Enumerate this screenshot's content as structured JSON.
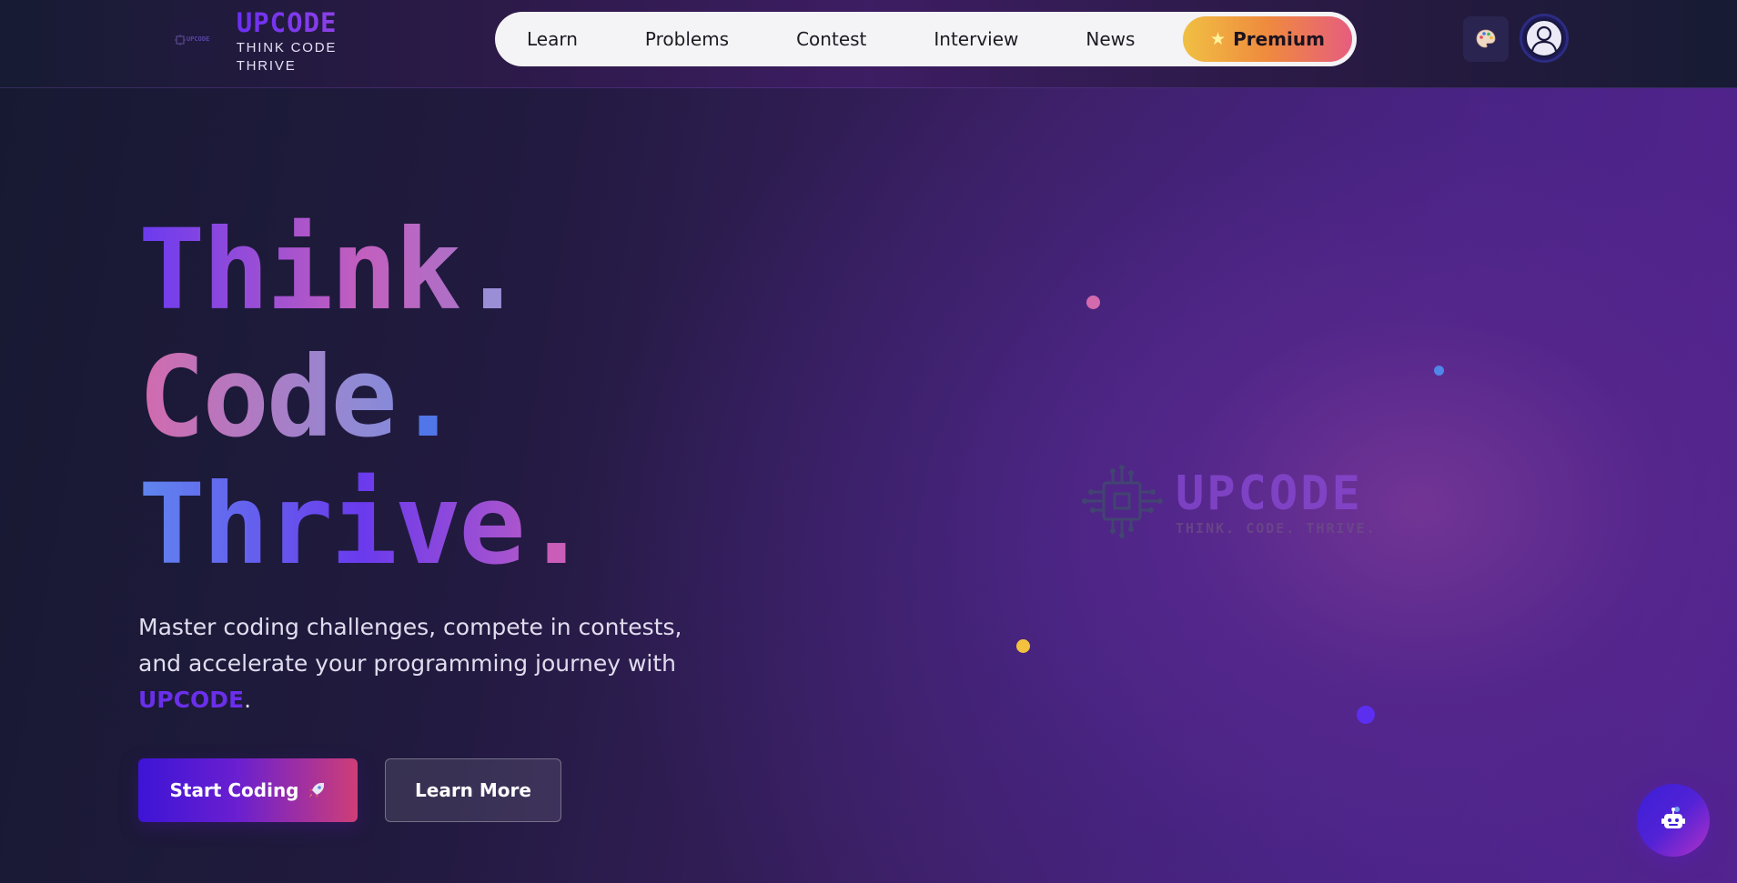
{
  "header": {
    "brand_name": "UPCODE",
    "brand_tagline": "THINK CODE THRIVE",
    "brand_mark_text": "UPCODE",
    "nav": [
      "Learn",
      "Problems",
      "Contest",
      "Interview",
      "News"
    ],
    "premium_label": "Premium",
    "premium_icon": "star-icon",
    "theme_icon": "palette-icon",
    "avatar_icon": "user-icon"
  },
  "hero": {
    "headline": [
      {
        "word": "Think",
        "dot": "."
      },
      {
        "word": "Code",
        "dot": "."
      },
      {
        "word": "Thrive",
        "dot": "."
      }
    ],
    "subtitle_text": "Master coding challenges, compete in contests, and accelerate your programming journey with",
    "subtitle_brand": "UPCODE",
    "subtitle_end": ".",
    "primary_cta": "Start Coding",
    "primary_cta_icon": "rocket-icon",
    "secondary_cta": "Learn More",
    "watermark_name": "UPCODE",
    "watermark_tagline": "THINK. CODE. THRIVE.",
    "chat_icon": "robot-icon"
  },
  "colors": {
    "brand_purple": "#6a2fea",
    "premium_gold": "#f0c043",
    "premium_pink": "#e65d7f",
    "particle_pink": "#d36aae",
    "particle_blue": "#4f86e8",
    "particle_yellow": "#f2c23e",
    "particle_indigo": "#5b2ef0"
  }
}
